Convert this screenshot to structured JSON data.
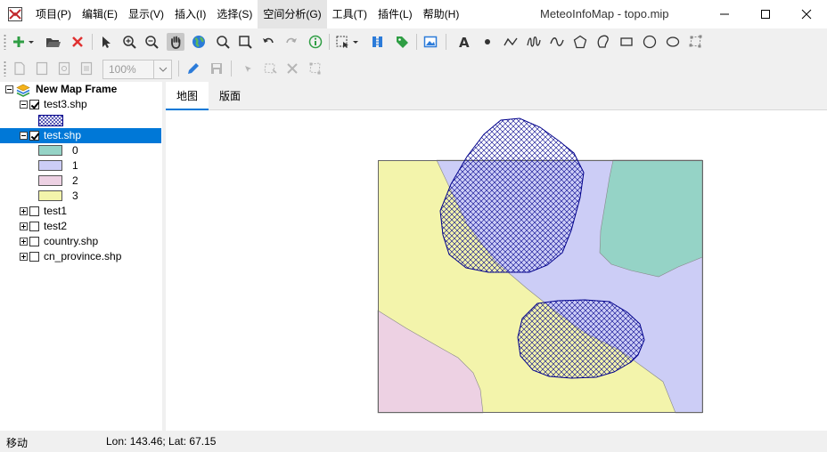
{
  "window": {
    "title": "MeteoInfoMap - topo.mip"
  },
  "menu": [
    {
      "label": "项目(P)"
    },
    {
      "label": "编辑(E)"
    },
    {
      "label": "显示(V)"
    },
    {
      "label": "插入(I)"
    },
    {
      "label": "选择(S)"
    },
    {
      "label": "空间分析(G)"
    },
    {
      "label": "工具(T)"
    },
    {
      "label": "插件(L)"
    },
    {
      "label": "帮助(H)"
    }
  ],
  "toolbar": {
    "icons": [
      "add-layer-icon",
      "open-folder-icon",
      "remove-icon",
      "select-pointer-icon",
      "zoom-in-icon",
      "zoom-out-icon",
      "pan-hand-icon",
      "full-extent-globe-icon",
      "magnifier-icon",
      "zoom-rectangle-icon",
      "undo-icon",
      "redo-icon",
      "identify-info-icon",
      "select-features-icon",
      "attribute-table-icon",
      "label-tag-icon",
      "add-image-icon",
      "text-icon",
      "point-icon",
      "polyline-icon",
      "freehand-icon",
      "curve-icon",
      "polygon-icon",
      "curve-polygon-icon",
      "rectangle-icon",
      "circle-icon",
      "ellipse-icon",
      "edit-vertices-icon"
    ],
    "zoom_value": "100%"
  },
  "legend": {
    "root": {
      "label": "New Map Frame"
    },
    "layers": [
      {
        "label": "test3.shp",
        "checked": true
      },
      {
        "label": "test.shp",
        "checked": true,
        "selected": true,
        "classes": [
          {
            "label": "0",
            "color": "#95d3c6"
          },
          {
            "label": "1",
            "color": "#cccdf6"
          },
          {
            "label": "2",
            "color": "#edd1e3"
          },
          {
            "label": "3",
            "color": "#f3f4ab"
          }
        ]
      },
      {
        "label": "test1",
        "checked": false
      },
      {
        "label": "test2",
        "checked": false
      },
      {
        "label": "country.shp",
        "checked": false
      },
      {
        "label": "cn_province.shp",
        "checked": false
      }
    ]
  },
  "tabs": [
    {
      "label": "地图"
    },
    {
      "label": "版面"
    }
  ],
  "status": {
    "mode": "移动",
    "coords": "Lon: 143.46; Lat: 67.15"
  }
}
